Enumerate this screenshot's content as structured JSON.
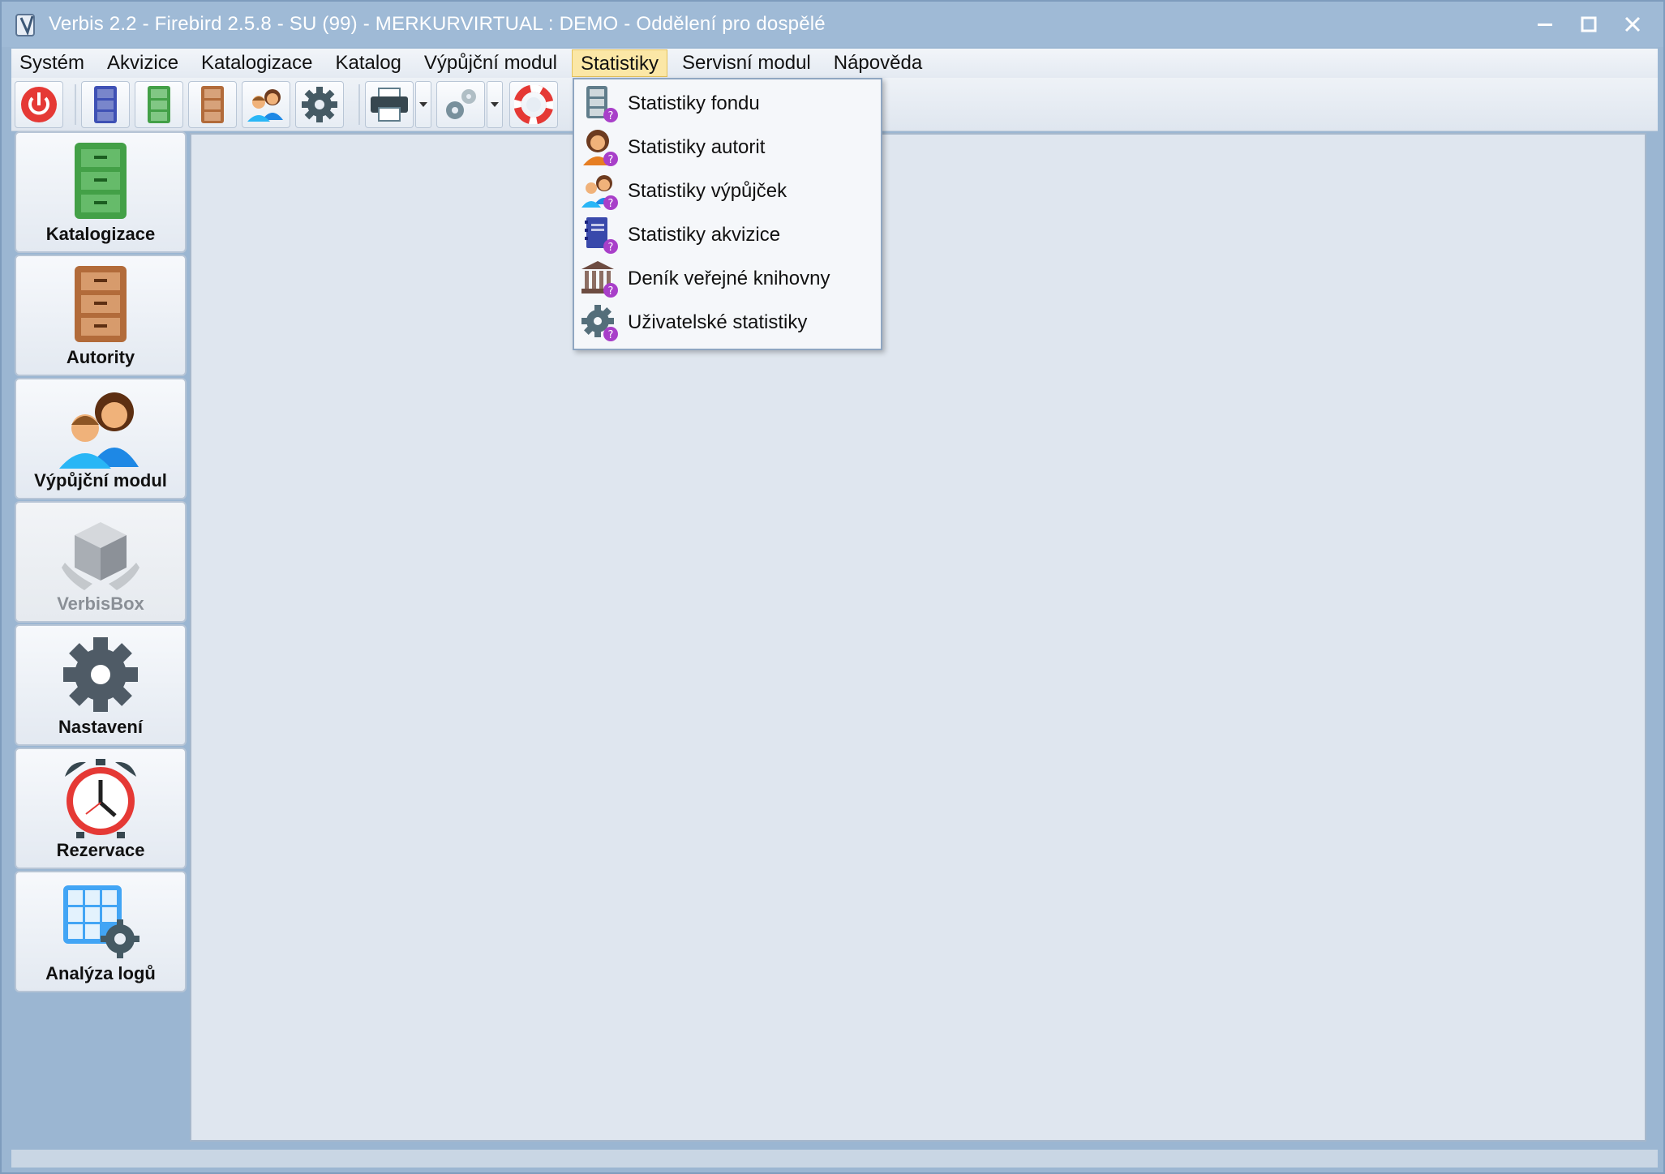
{
  "window": {
    "title": "Verbis 2.2 - Firebird 2.5.8 - SU (99) - MERKURVIRTUAL : DEMO - Oddělení pro dospělé"
  },
  "menubar": {
    "items": [
      "Systém",
      "Akvizice",
      "Katalogizace",
      "Katalog",
      "Výpůjční modul",
      "Statistiky",
      "Servisní modul",
      "Nápověda"
    ],
    "active": "Statistiky"
  },
  "toolbar": {
    "buttons": [
      "power-icon",
      "blue-cabinet-icon",
      "green-cabinet-icon",
      "brown-cabinet-icon",
      "users-icon",
      "gear-icon",
      "printer-icon",
      "gears-icon",
      "lifebuoy-icon"
    ]
  },
  "sidebar": {
    "items": [
      {
        "label": "Katalogizace",
        "icon": "green-cabinet-icon",
        "enabled": true
      },
      {
        "label": "Autority",
        "icon": "brown-cabinet-icon",
        "enabled": true
      },
      {
        "label": "Výpůjční modul",
        "icon": "users-icon",
        "enabled": true
      },
      {
        "label": "VerbisBox",
        "icon": "box-icon",
        "enabled": false
      },
      {
        "label": "Nastavení",
        "icon": "gear-icon",
        "enabled": true
      },
      {
        "label": "Rezervace",
        "icon": "alarm-clock-icon",
        "enabled": true
      },
      {
        "label": "Analýza logů",
        "icon": "grid-gear-icon",
        "enabled": true
      }
    ]
  },
  "statistiky_menu": {
    "items": [
      {
        "label": "Statistiky fondu",
        "icon": "cabinet-question-icon"
      },
      {
        "label": "Statistiky autorit",
        "icon": "person-question-icon"
      },
      {
        "label": "Statistiky výpůjček",
        "icon": "users-question-icon"
      },
      {
        "label": "Statistiky akvizice",
        "icon": "notebook-question-icon"
      },
      {
        "label": "Deník veřejné knihovny",
        "icon": "library-question-icon"
      },
      {
        "label": "Uživatelské statistiky",
        "icon": "gear-question-icon"
      }
    ]
  },
  "colors": {
    "titlebar": "#9fbad6",
    "menu_active": "#fbe7a6",
    "workspace": "#dfe6ef",
    "question_badge": "#a83fc9"
  }
}
